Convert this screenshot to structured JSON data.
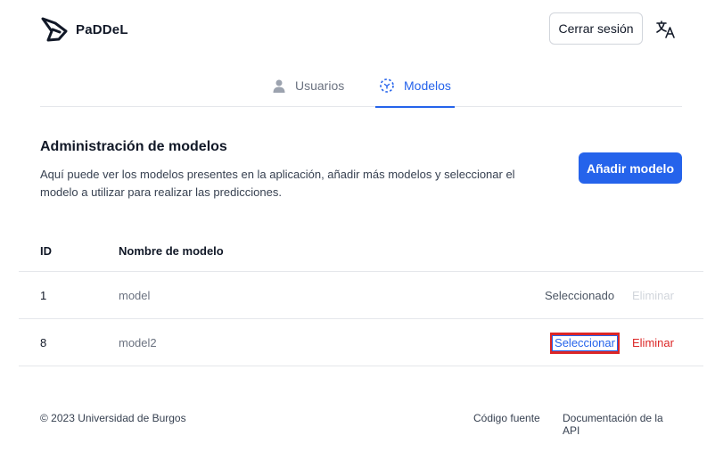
{
  "header": {
    "app_name": "PaDDeL",
    "logout_label": "Cerrar sesión"
  },
  "tabs": [
    {
      "label": "Usuarios",
      "active": false
    },
    {
      "label": "Modelos",
      "active": true
    }
  ],
  "section": {
    "title": "Administración de modelos",
    "description": "Aquí puede ver los modelos presentes en la aplicación, añadir más modelos y seleccionar el modelo a utilizar para realizar las predicciones.",
    "add_button_label": "Añadir modelo"
  },
  "table": {
    "columns": [
      "ID",
      "Nombre de modelo"
    ],
    "rows": [
      {
        "id": "1",
        "name": "model",
        "status": "Seleccionado",
        "delete_label": "Eliminar",
        "delete_enabled": false
      },
      {
        "id": "8",
        "name": "model2",
        "select_label": "Seleccionar",
        "delete_label": "Eliminar",
        "delete_enabled": true
      }
    ]
  },
  "footer": {
    "copyright": "© 2023 Universidad de Burgos",
    "links": [
      "Código fuente",
      "Documentación de la API"
    ]
  },
  "colors": {
    "accent": "#2563eb",
    "danger": "#dc2626",
    "highlight_box": "#dc2626"
  }
}
